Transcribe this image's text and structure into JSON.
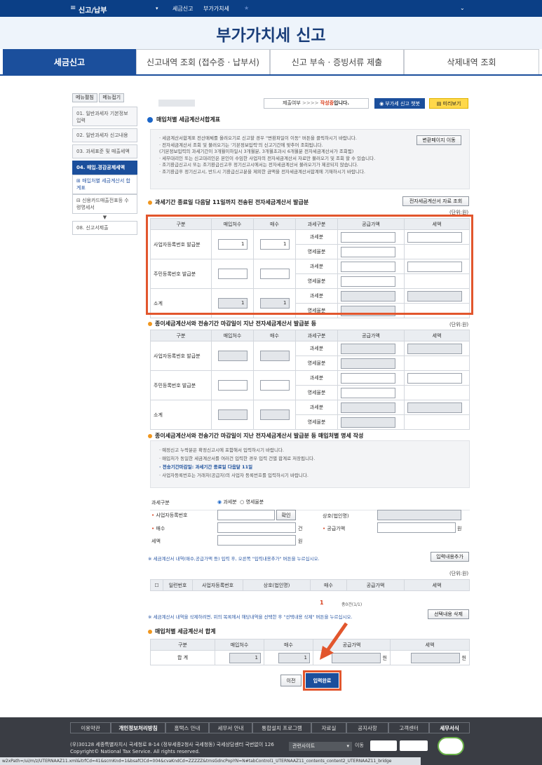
{
  "topbar": {
    "menu": "신고/납부",
    "crumb1": "세금신고",
    "crumb2": "부가가치세"
  },
  "page_title": "부가가치세 신고",
  "tabs": [
    "세금신고",
    "신고내역 조회 (접수증 · 납부서)",
    "신고 부속 · 증빙서류 제출",
    "삭제내역 조회"
  ],
  "lnav": {
    "btn_expand": "메뉴펼침",
    "btn_collapse": "메뉴접기",
    "items": [
      "01. 일반과세자 기본정보 입력",
      "02. 일반과세자 신고내용",
      "03. 과세표준 및 매출세액",
      "04. 매입.경감공제세액"
    ],
    "subitems": [
      "매입처별 세금계산서 합계표",
      "신용카드매출전표등 수령명세서"
    ],
    "last": "08. 신고서제출"
  },
  "status_bar": {
    "label": "제출여부",
    "arrows": ">>>>",
    "state": "작성중",
    "suffix": "입니다.",
    "chatbot": "부가세 신고 챗봇",
    "preview": "미리보기"
  },
  "section_title": "매입처별 세금계산서합계표",
  "notice_lines": [
    "· 세금계산서합계표 전산매체를 올려오기로 신고할 경우 \"변환파일이 이동\" 버튼을 클릭하시기 바랍니다.",
    "· 전자세금계산서 조회 및 불러오기는 '기본정보입력'의 신고기간에 맞추어 조회됩니다.",
    "  (기본정보입력의 과세기간이 3개월이하일시 3개월분, 3개월초과시 6개월분 전자세금계산서가 조회됨)",
    "· 세무대리인 또는 신고대리인은 본인이 수임한 사업자의 전자세금계산서 자료만 불러오기 및 조회 할 수 있습니다.",
    "· 조기환급신고시 또는 조기환급신고후 정기신고시에서는 전자세금계산서 불러오기가 제공되지 않습니다.",
    "· 조기환급후 정기신고시, 반드시 기환급신고분을 제외한 금액을 전자세금계산서합계에 기재하시기 바랍니다."
  ],
  "btn_convert": "변환페이지 이동",
  "sec1": {
    "title": "과세기간 종료일 다음달 11일까지 전송된 전자세금계산서 발급분",
    "btn": "전자세금계산서 자료 조회",
    "unit": "(단위:원)"
  },
  "table_headers": [
    "구분",
    "매입처수",
    "매수",
    "과세구분",
    "공급가액",
    "세액"
  ],
  "row_labels": [
    "사업자등록번호 발급분",
    "주민등록번호 발급분",
    "소계"
  ],
  "tax_types": [
    "과세분",
    "영세율분"
  ],
  "t1_values": {
    "r1_count": "1",
    "r1_sheets": "1",
    "r3_count": "1",
    "r3_sheets": "1"
  },
  "sec2": {
    "title": "종이세금계산서와 전송기간 마감일이 지난 전자세금계산서 발급분 등",
    "unit": "(단위:원)"
  },
  "sec3": {
    "title": "종이세금계산서와 전송기간 마감일이 지난 전자세금계산서 발급분 등 매입처별 명세 작성"
  },
  "notice2": [
    "· 예정신고 누락분은 확정신고시에 포함해서 입력하시기 바랍니다.",
    "· 매입처가 동일한 세금계산서를 여러건 입력한 경우 입력 건별 합계로 저장됩니다.",
    "· 전송기간마감일: 과세기간 종료일 다음달 11일",
    "· 사업자등록번호는 거래처(공급자)의 사업자 등록번호를 입력하시기 바랍니다."
  ],
  "form": {
    "tax_type": "과세구분",
    "opt1": "과세분",
    "opt2": "영세율분",
    "biz_no": "사업자등록번호",
    "confirm": "확인",
    "company": "상호(법인명)",
    "sheets": "매수",
    "unit_gun": "건",
    "supply": "공급가액",
    "won": "원",
    "tax": "세액"
  },
  "add_note": "※ 세금계산서 내역(매수,공급가액 등) 입력 후, 오른쪽 \"입력내용추가\" 버튼을 누르십시오.",
  "btn_add": "입력내용추가",
  "list_unit": "(단위:원)",
  "list_headers": [
    "일련번호",
    "사업자등록번호",
    "상호(법인명)",
    "매수",
    "공급가액",
    "세액"
  ],
  "paging": {
    "page": "1",
    "count": "총0건(1/1)"
  },
  "del_note": "※ 세금계산서 내역을 삭제하려면, 위의 목록에서 해당내역을 선택한 후 \"선택내용 삭제\" 버튼을 누르십시오.",
  "btn_delete": "선택내용 삭제",
  "sum_title": "매입처별 세금계산서 합계",
  "sum_headers": [
    "구분",
    "매입처수",
    "매수",
    "공급가액",
    "세액"
  ],
  "sum_row": {
    "label": "합 계",
    "count": "1",
    "sheets": "1",
    "won": "원"
  },
  "btn_prev": "이전",
  "btn_done": "입력완료",
  "footer": {
    "links": [
      "이용약관",
      "개인정보처리방침",
      "홈택스 안내",
      "세무서 안내",
      "통합설치 프로그램",
      "자료실",
      "공지사항",
      "고객센터",
      "세무서식"
    ],
    "address": "(우)30128 세종특별자치시 국세청로 8-14 (정부세종2청사 국세청동) 국세상담센터 국번없이 126",
    "copyright": "Copyright© National Tax Service. All rights reserved.",
    "related": "관련사이트",
    "go": "이동"
  },
  "url": "w2xPath=/ui/m/z/UTERNAAZ11.xml&itrfCd=41&scrnKnd=1&bsafClCd=004&cvaKndCd=ZZZZZ&trnsGdncPopYN=N#tabControl1_UTERNAAZ11_contents_content2_UTERNAAZ11_bridge",
  "colors": {
    "primary": "#1b4f9c",
    "highlight": "#e2562d",
    "accent": "#f0961e"
  }
}
